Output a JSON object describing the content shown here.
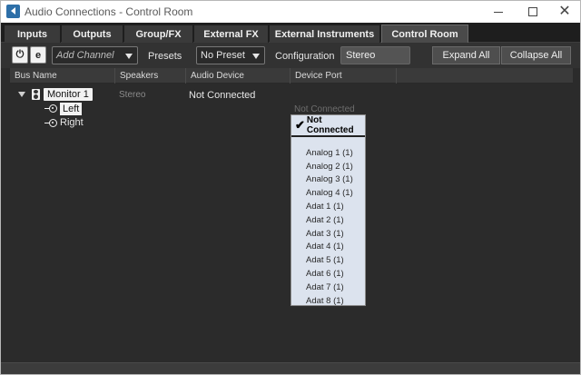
{
  "window": {
    "title": "Audio Connections - Control Room",
    "minimize_icon": "minimize-icon",
    "maximize_icon": "maximize-icon",
    "close_icon": "close-icon",
    "close_glyph": "✕"
  },
  "tabs": [
    {
      "label": "Inputs"
    },
    {
      "label": "Outputs"
    },
    {
      "label": "Group/FX"
    },
    {
      "label": "External FX"
    },
    {
      "label": "External Instruments"
    },
    {
      "label": "Control Room",
      "active": true
    }
  ],
  "toolbar": {
    "power_glyph": "⏻",
    "edit_glyph": "e",
    "add_channel": "Add Channel",
    "presets_label": "Presets",
    "preset_value": "No Preset",
    "configuration_label": "Configuration",
    "configuration_value": "Stereo",
    "expand_all": "Expand All",
    "collapse_all": "Collapse All"
  },
  "columns": [
    "Bus Name",
    "Speakers",
    "Audio Device",
    "Device Port"
  ],
  "bus": {
    "name": "Monitor 1",
    "speakers": "Stereo",
    "audio_device": "Not Connected",
    "channels": [
      {
        "name": "Left",
        "port": "Not Connected"
      },
      {
        "name": "Right"
      }
    ]
  },
  "port_dropdown": {
    "selected": "Not Connected",
    "check_glyph": "✔",
    "options": [
      "Analog 1 (1)",
      "Analog 2 (1)",
      "Analog 3 (1)",
      "Analog 4 (1)",
      "Adat 1 (1)",
      "Adat 2 (1)",
      "Adat 3 (1)",
      "Adat 4 (1)",
      "Adat 5 (1)",
      "Adat 6 (1)",
      "Adat 7 (1)",
      "Adat 8 (1)"
    ]
  },
  "colors": {
    "background": "#2b2b2b",
    "tab_active": "#4a4a4a",
    "popup_bg": "#dce3ee"
  }
}
